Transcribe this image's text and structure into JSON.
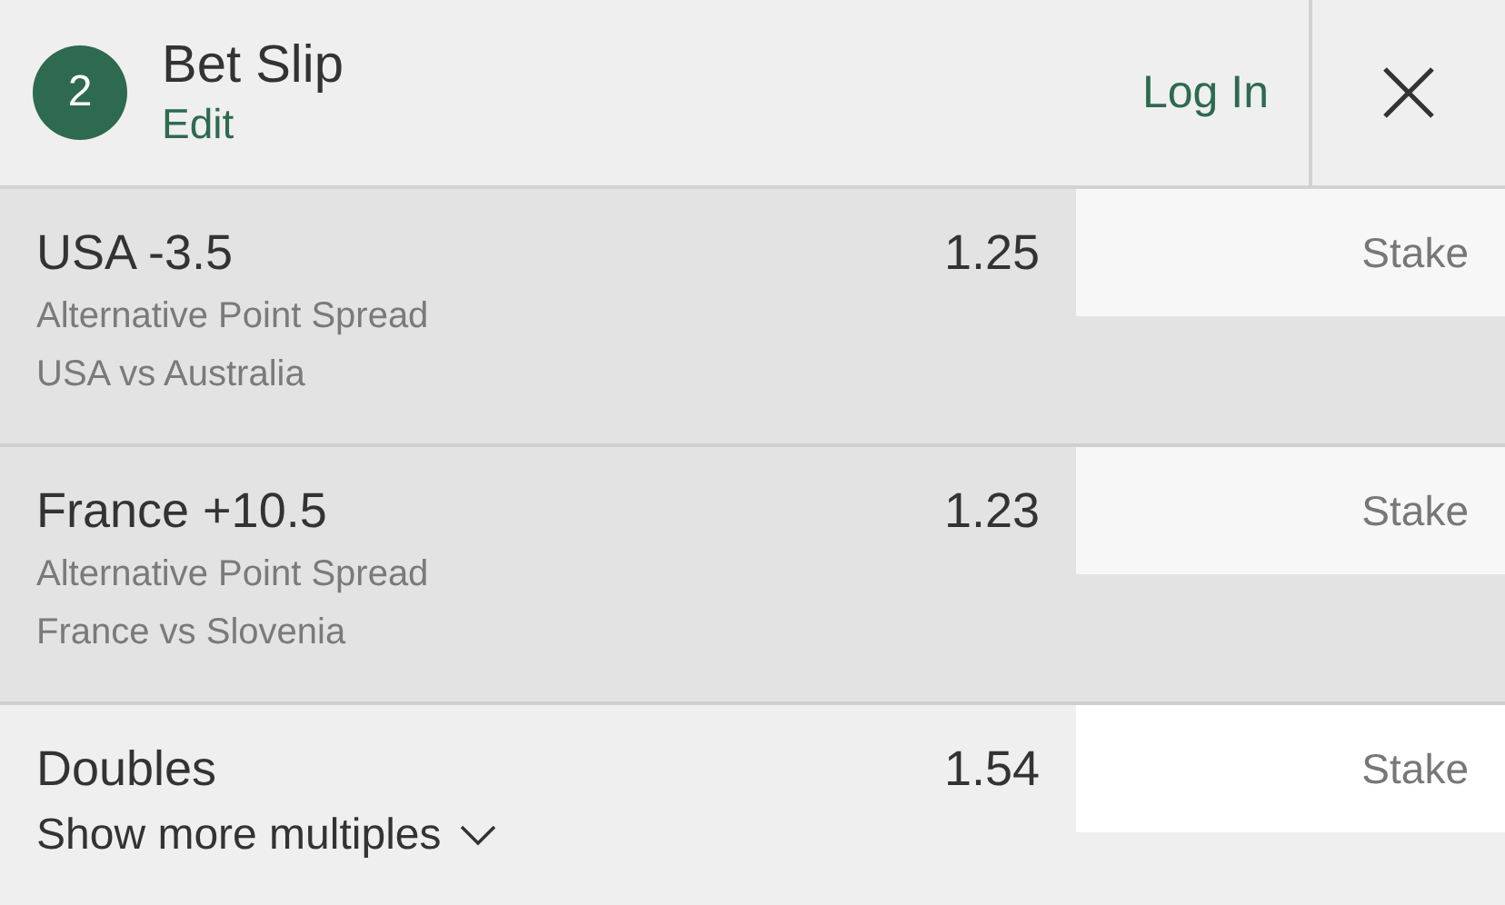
{
  "header": {
    "badge": "2",
    "title": "Bet Slip",
    "edit": "Edit",
    "login": "Log In"
  },
  "bets": [
    {
      "selection": "USA -3.5",
      "odds": "1.25",
      "market": "Alternative Point Spread",
      "event": "USA vs Australia",
      "stake_placeholder": "Stake"
    },
    {
      "selection": "France +10.5",
      "odds": "1.23",
      "market": "Alternative Point Spread",
      "event": "France vs Slovenia",
      "stake_placeholder": "Stake"
    }
  ],
  "multiples": {
    "label": "Doubles",
    "odds": "1.54",
    "toggle": "Show more multiples",
    "expanded": false,
    "stake_placeholder": "Stake"
  }
}
